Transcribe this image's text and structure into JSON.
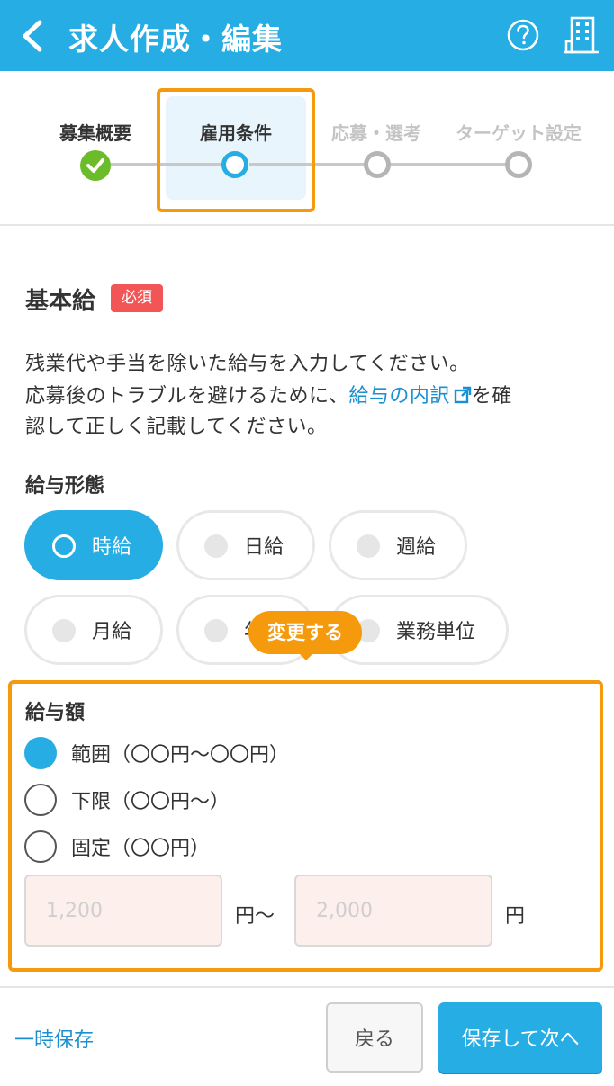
{
  "header": {
    "title": "求人作成・編集",
    "back_icon": "chevron-left-icon",
    "help_icon": "question-circle-icon",
    "company_icon": "building-icon",
    "bg_color": "#26ade4"
  },
  "stepper": {
    "steps": [
      {
        "label": "募集概要",
        "state": "done"
      },
      {
        "label": "雇用条件",
        "state": "active"
      },
      {
        "label": "応募・選考",
        "state": "future"
      },
      {
        "label": "ターゲット設定",
        "state": "future"
      }
    ],
    "highlight_color": "#f59a0c"
  },
  "section": {
    "title": "基本給",
    "required_badge": "必須",
    "desc_line1": "残業代や手当を除いた給与を入力してください。",
    "desc_line2_prefix": "応募後のトラブルを避けるために、",
    "desc_line2_link": "給与の内訳",
    "desc_line2_suffix": "を確",
    "desc_line3": "認して正しく記載してください。"
  },
  "pay_type": {
    "label": "給与形態",
    "options": [
      "時給",
      "日給",
      "週給",
      "月給",
      "年",
      "業務単位"
    ],
    "selected": "時給"
  },
  "tooltip": {
    "text": "変更する"
  },
  "amount": {
    "label": "給与額",
    "options": [
      "範囲（〇〇円〜〇〇円）",
      "下限（〇〇円〜）",
      "固定（〇〇円）"
    ],
    "selected": "範囲（〇〇円〜〇〇円）",
    "min_placeholder": "1,200",
    "max_placeholder": "2,000",
    "unit_range": "円〜",
    "unit": "円"
  },
  "footer": {
    "temp_save": "一時保存",
    "back": "戻る",
    "next": "保存して次へ"
  },
  "colors": {
    "accent": "#26ade4",
    "done": "#6cbb2b",
    "required": "#f25555",
    "highlight": "#f59a0c",
    "link": "#1a8fd1"
  }
}
